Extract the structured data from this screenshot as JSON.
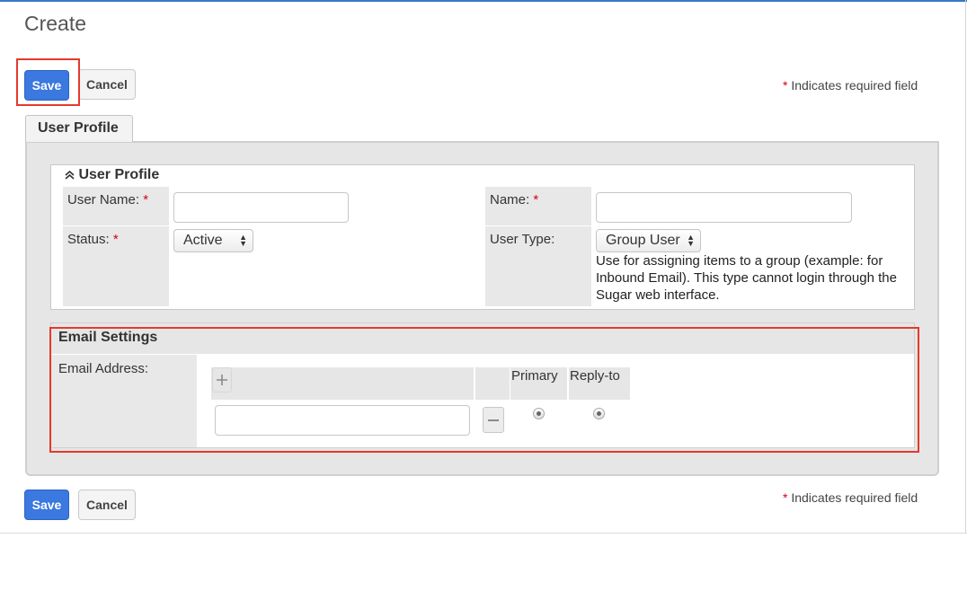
{
  "page": {
    "title": "Create"
  },
  "toolbar_top": {
    "save_label": "Save",
    "cancel_label": "Cancel"
  },
  "toolbar_bottom": {
    "save_label": "Save",
    "cancel_label": "Cancel"
  },
  "required_note": {
    "star": "*",
    "text": "Indicates required field"
  },
  "tab": {
    "label": "User Profile"
  },
  "user_profile": {
    "header": "User Profile",
    "collapse_icon": "chevron-double-up-icon",
    "fields": {
      "user_name": {
        "label": "User Name:",
        "star": "*",
        "value": ""
      },
      "name": {
        "label": "Name:",
        "star": "*",
        "value": ""
      },
      "status": {
        "label": "Status:",
        "star": "*",
        "selected": "Active"
      },
      "user_type": {
        "label": "User Type:",
        "selected": "Group User",
        "help": "Use for assigning items to a group (example: for Inbound Email). This type cannot login through the Sugar web interface."
      }
    }
  },
  "email_settings": {
    "header": "Email Settings",
    "email_label": "Email Address:",
    "add_icon": "plus-icon",
    "remove_icon": "minus-icon",
    "columns": {
      "primary": "Primary",
      "reply_to": "Reply-to"
    },
    "rows": [
      {
        "address": "",
        "primary": true,
        "reply_to": true
      }
    ]
  },
  "colors": {
    "accent": "#3b78e0",
    "highlight": "#e53a2c",
    "required": "#d0021b"
  }
}
